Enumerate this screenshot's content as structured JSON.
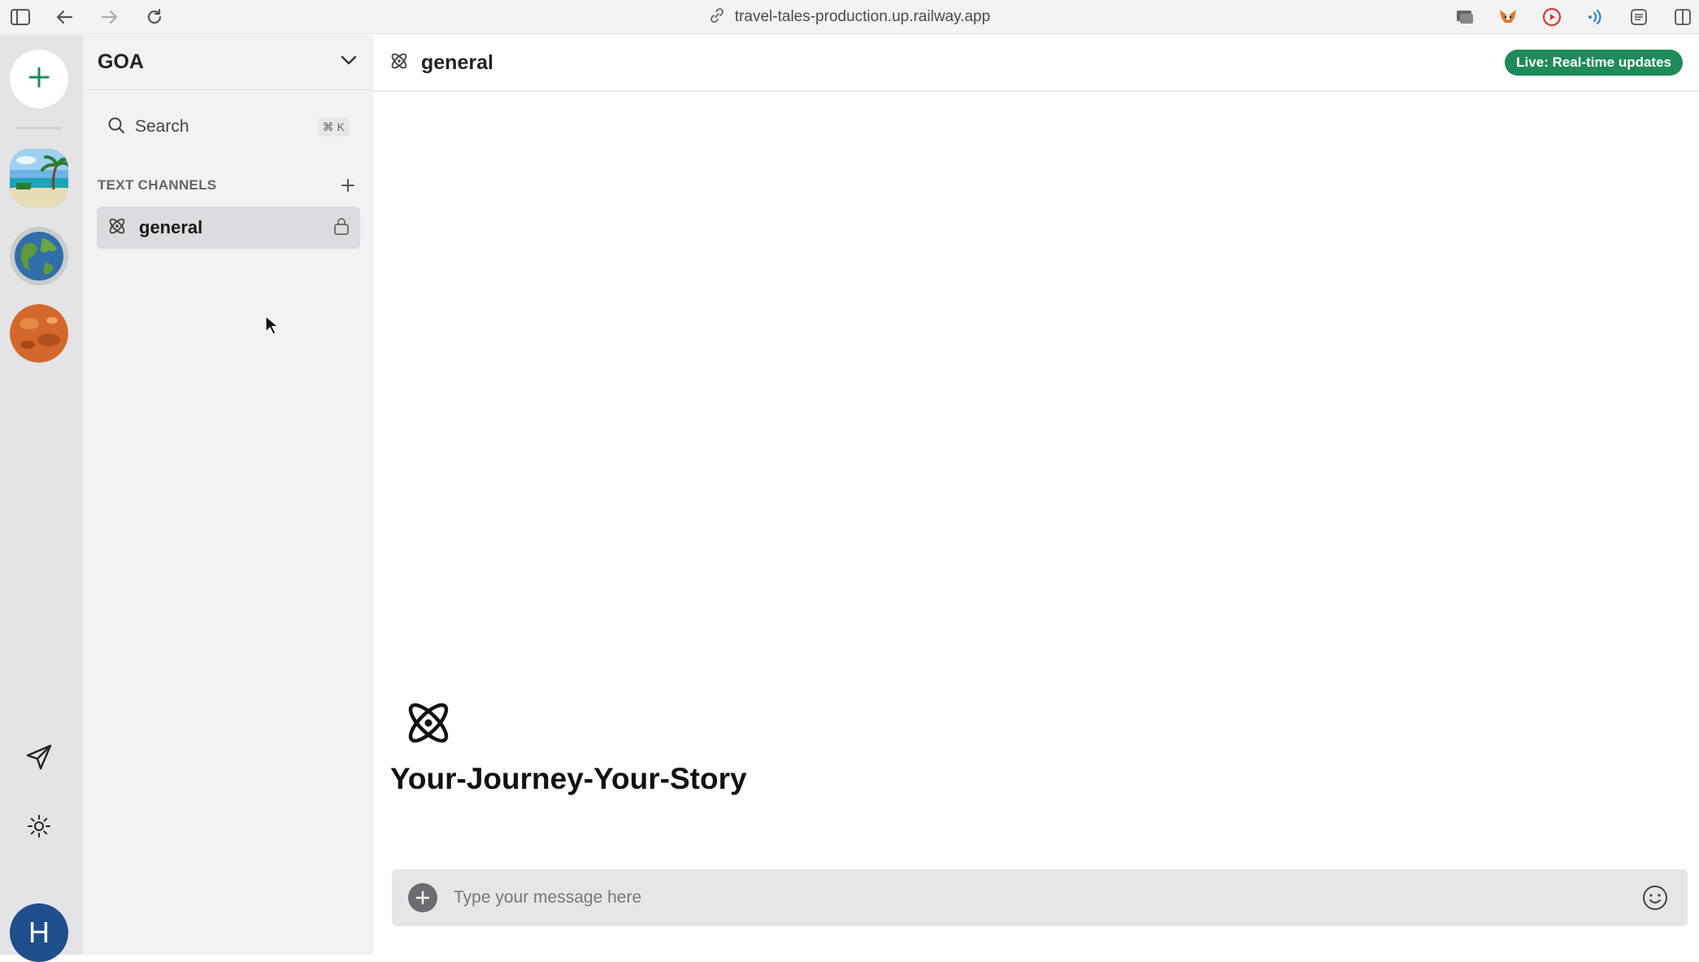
{
  "browser": {
    "url": "travel-tales-production.up.railway.app",
    "icons": [
      "sidebar-toggle-icon",
      "back-icon",
      "forward-icon",
      "reload-icon",
      "link-icon",
      "screen-icon",
      "metamask-icon",
      "record-icon",
      "audio-icon",
      "reader-icon",
      "split-view-icon"
    ]
  },
  "rail": {
    "servers": [
      {
        "name": "beach"
      },
      {
        "name": "globe"
      },
      {
        "name": "mars"
      }
    ],
    "user_initial": "H"
  },
  "sidebar": {
    "server_name": "GOA",
    "search_label": "Search",
    "search_shortcut": "⌘ K",
    "section_title": "TEXT CHANNELS",
    "channels": [
      {
        "label": "general"
      }
    ]
  },
  "main": {
    "channel_title": "general",
    "live_badge": "Live: Real-time updates",
    "welcome_title": "Your-Journey-Your-Story",
    "composer_placeholder": "Type your message here"
  },
  "colors": {
    "accent_green": "#1f8a5a",
    "rail_bg": "#e4e4e6",
    "sidebar_bg": "#f2f2f3",
    "avatar_blue": "#1e4f8c"
  }
}
